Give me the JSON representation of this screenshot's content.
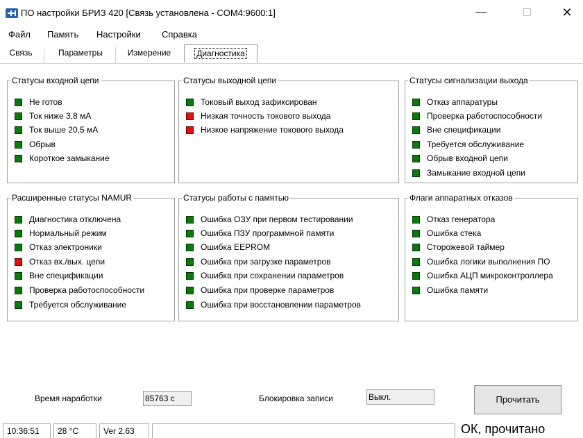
{
  "window": {
    "title": "ПО настройки БРИЗ 420 [Связь установлена - COM4:9600:1]",
    "minimize_glyph": "—",
    "close_glyph": "✕",
    "icon": "app-network-icon"
  },
  "menu": [
    "Файл",
    "Память",
    "Настройки",
    "Справка"
  ],
  "tabs": [
    "Связь",
    "Параметры",
    "Измерение",
    "Диагностика"
  ],
  "active_tab": "Диагностика",
  "colors": {
    "led_ok": "#0a7a0a",
    "led_fault": "#e01010"
  },
  "panels": {
    "input_status": {
      "title": "Статусы входной цепи",
      "items": [
        {
          "label": "Не готов",
          "state": "green"
        },
        {
          "label": "Ток ниже 3,8 мА",
          "state": "green"
        },
        {
          "label": "Ток выше 20,5 мА",
          "state": "green"
        },
        {
          "label": "Обрыв",
          "state": "green"
        },
        {
          "label": "Короткое замыкание",
          "state": "green"
        }
      ]
    },
    "output_status": {
      "title": "Статусы выходной цепи",
      "items": [
        {
          "label": "Токовый выход зафиксирован",
          "state": "green"
        },
        {
          "label": "Низкая точность токового выхода",
          "state": "red"
        },
        {
          "label": "Низкое напряжение токового выхода",
          "state": "red"
        }
      ]
    },
    "alarm_status": {
      "title": "Статусы сигнализации выхода",
      "items": [
        {
          "label": "Отказ аппаратуры",
          "state": "green"
        },
        {
          "label": "Проверка работоспособности",
          "state": "green"
        },
        {
          "label": "Вне спецификации",
          "state": "green"
        },
        {
          "label": "Требуется обслуживание",
          "state": "green"
        },
        {
          "label": "Обрыв входной цепи",
          "state": "green"
        },
        {
          "label": "Замыкание входной цепи",
          "state": "green"
        }
      ]
    },
    "namur_status": {
      "title": "Расширенные статусы NAMUR",
      "items": [
        {
          "label": "Диагностика отключена",
          "state": "green"
        },
        {
          "label": "Нормальный режим",
          "state": "green"
        },
        {
          "label": "Отказ электроники",
          "state": "green"
        },
        {
          "label": "Отказ вх./вых. цепи",
          "state": "red"
        },
        {
          "label": "Вне спецификации",
          "state": "green"
        },
        {
          "label": "Проверка работоспособности",
          "state": "green"
        },
        {
          "label": "Требуется обслуживание",
          "state": "green"
        }
      ]
    },
    "memory_status": {
      "title": "Статусы работы с памятью",
      "items": [
        {
          "label": "Ошибка ОЗУ при первом тестировании",
          "state": "green"
        },
        {
          "label": "Ошибка ПЗУ программной памяти",
          "state": "green"
        },
        {
          "label": "Ошибка EEPROM",
          "state": "green"
        },
        {
          "label": "Ошибка при загрузке параметров",
          "state": "green"
        },
        {
          "label": "Ошибка при сохранении параметров",
          "state": "green"
        },
        {
          "label": "Ошибка при проверке параметров",
          "state": "green"
        },
        {
          "label": "Ошибка при восстановлении параметров",
          "state": "green"
        }
      ]
    },
    "hw_flags": {
      "title": "Флаги аппаратных отказов",
      "items": [
        {
          "label": "Отказ генератора",
          "state": "green"
        },
        {
          "label": "Ошибка стека",
          "state": "green"
        },
        {
          "label": "Сторожевой таймер",
          "state": "green"
        },
        {
          "label": "Ошибка логики выполнения ПО",
          "state": "green"
        },
        {
          "label": "Ошибка АЦП микроконтроллера",
          "state": "green"
        },
        {
          "label": "Ошибка памяти",
          "state": "green"
        }
      ]
    }
  },
  "bottom": {
    "runtime_label": "Время наработки",
    "runtime_value": "85763 с",
    "lock_label": "Блокировка записи",
    "lock_value": "Выкл.",
    "read_button": "Прочитать"
  },
  "statusbar": {
    "time": "10:36:51",
    "temperature": "28 °C",
    "version": "Ver 2.63",
    "progress": "",
    "message": "ОК, прочитано"
  }
}
